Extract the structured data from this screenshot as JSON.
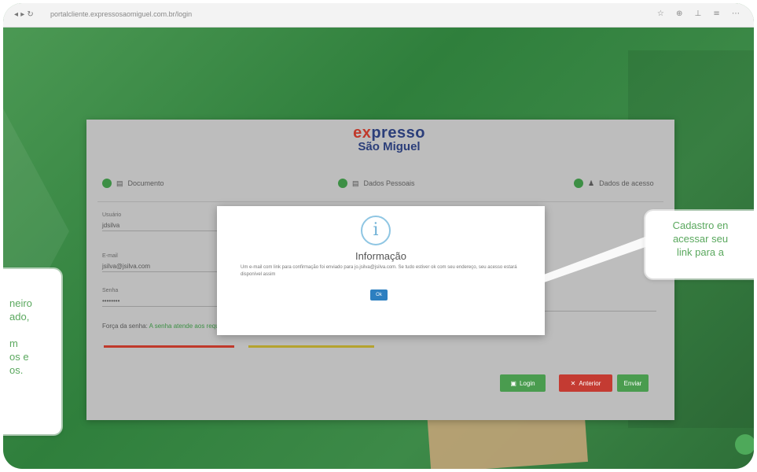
{
  "browser": {
    "nav": "◂ ▸ ↻",
    "url": "portalcliente.expressosaomiguel.com.br/login",
    "tools": "☆ ⊕ ⊥ ≡ ⋯"
  },
  "logo": {
    "line1_a": "e",
    "line1_x": "x",
    "line1_b": "presso",
    "line2": "São Miguel"
  },
  "steps": [
    {
      "label": "Documento"
    },
    {
      "label": "Dados Pessoais"
    },
    {
      "label": "Dados de acesso"
    }
  ],
  "form": {
    "field1_label": "Usuário",
    "field1_value": "jdsilva",
    "field2_label": "E-mail",
    "field2_value": "jsilva@jsilva.com",
    "field3_label": "Senha",
    "field3_value": "••••••••",
    "strength_prefix": "Força da senha:",
    "strength_value": "A senha atende aos requisitos"
  },
  "buttons": {
    "login": "Login",
    "back": "Anterior",
    "next": "Enviar"
  },
  "modal": {
    "icon": "i",
    "title": "Informação",
    "text": "Um e-mail com link para confirmação foi enviado para jo.jsilva@jsilva.com. Se tudo estiver ok com seu endereço, seu acesso estará disponível assim",
    "ok": "Ok"
  },
  "callout_left": [
    "neiro",
    "ado,",
    "",
    "m",
    "os e",
    "os."
  ],
  "callout_right": [
    "Cadastro en",
    "acessar seu",
    "link para a"
  ],
  "colors": {
    "accent_green": "#5aa85e",
    "primary_blue": "#2d7fc0",
    "danger_red": "#c43b32"
  }
}
